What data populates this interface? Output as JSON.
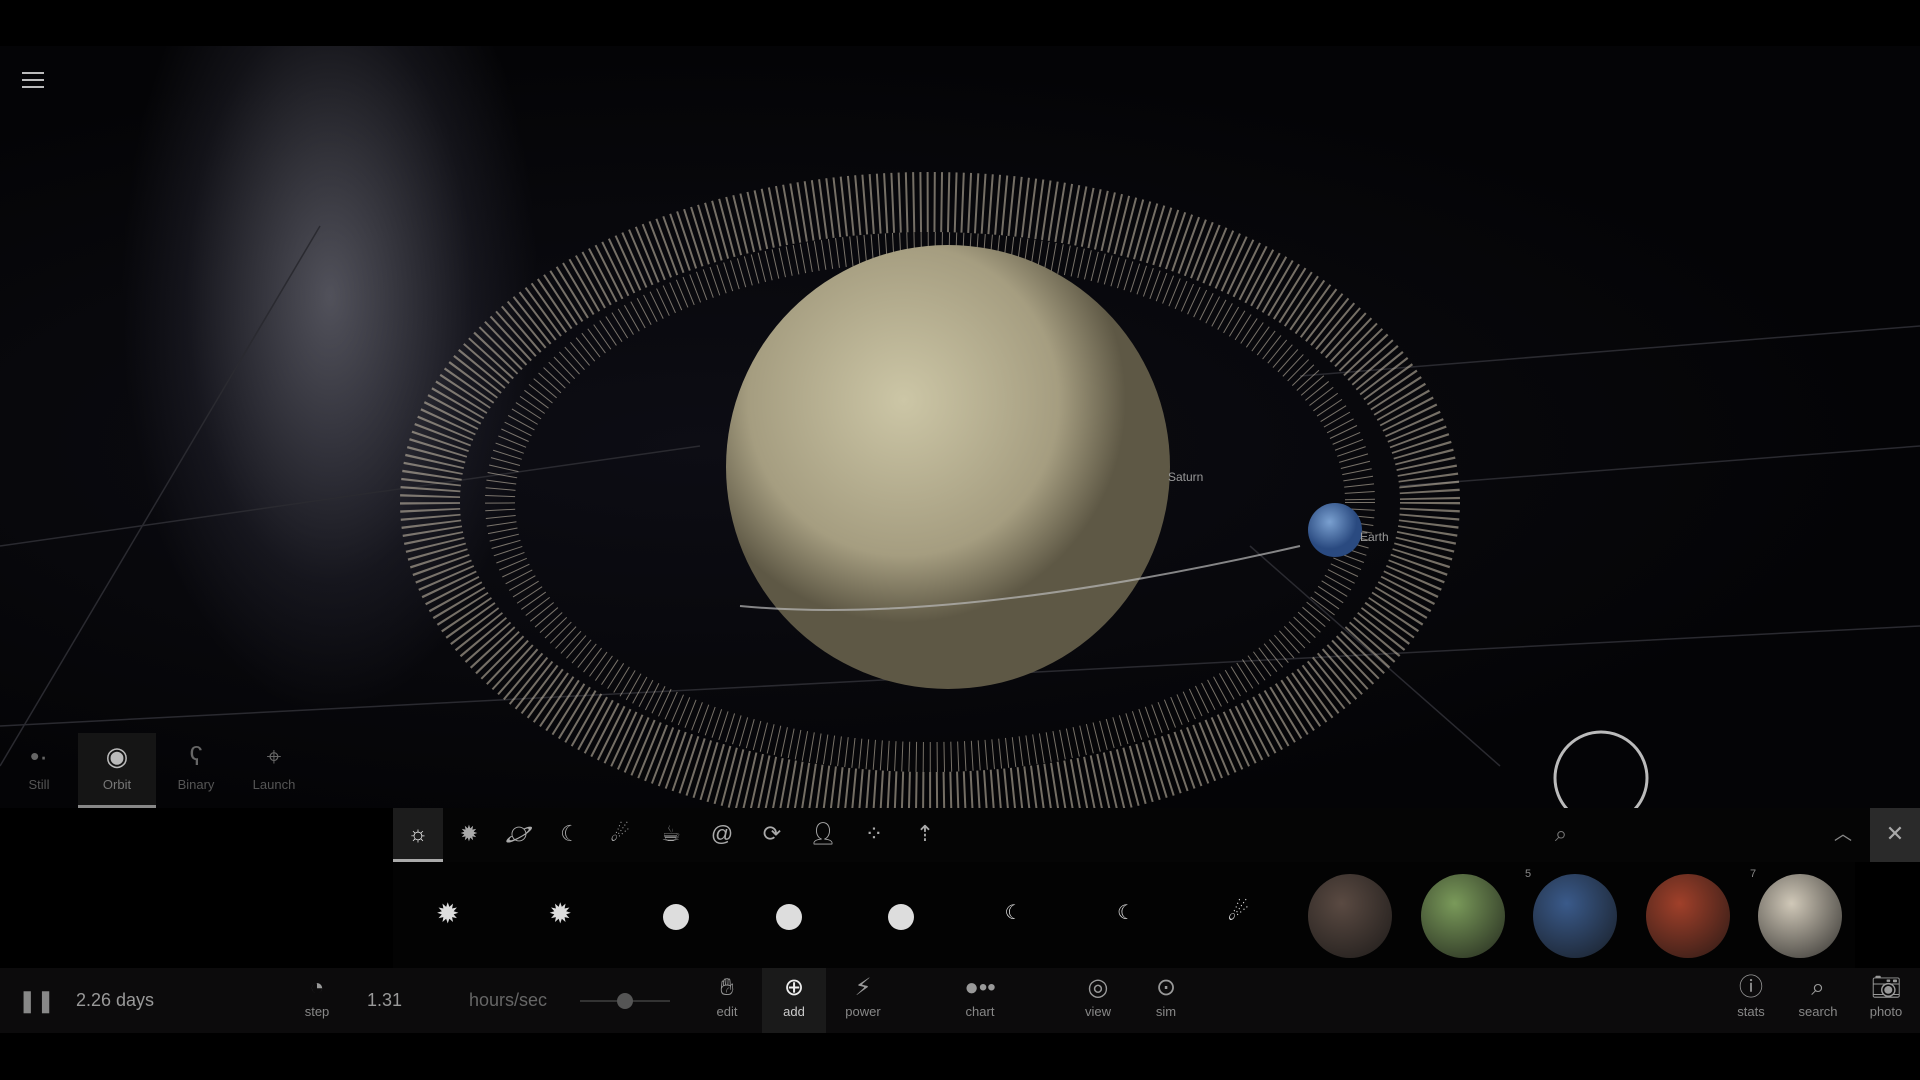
{
  "scene": {
    "labels": {
      "saturn": "Saturn",
      "earth": "Earth"
    }
  },
  "modes": [
    {
      "label": "Still",
      "icon": "still-icon"
    },
    {
      "label": "Orbit",
      "icon": "orbit-icon",
      "active": true
    },
    {
      "label": "Binary",
      "icon": "binary-icon"
    },
    {
      "label": "Launch",
      "icon": "launch-icon"
    }
  ],
  "categories": [
    "sun-planet-icon",
    "star-icon",
    "planet-ring-icon",
    "moon-icon",
    "comet-icon",
    "teapot-icon",
    "galaxy-icon",
    "black-hole-icon",
    "person-icon",
    "ring-dots-icon",
    "launch-arrow-icon"
  ],
  "palette": {
    "items": [
      {
        "kind": "star"
      },
      {
        "kind": "star"
      },
      {
        "kind": "white-dwarf"
      },
      {
        "kind": "white-dwarf"
      },
      {
        "kind": "white-dwarf"
      },
      {
        "kind": "moon"
      },
      {
        "kind": "moon"
      },
      {
        "kind": "comet"
      },
      {
        "kind": "planet",
        "color": "#5a4a42"
      },
      {
        "kind": "planet",
        "color": "#7a9a5a"
      },
      {
        "kind": "planet",
        "color": "#3a5a8a",
        "badge": "5"
      },
      {
        "kind": "planet",
        "color": "#a0402a"
      },
      {
        "kind": "planet",
        "color": "#d0c8b8",
        "badge": "7"
      }
    ]
  },
  "bottom": {
    "time": "2.26 days",
    "step": "step",
    "rate": "1.31",
    "rate_unit": "hours/sec",
    "rate_slider": 0.5,
    "tools": {
      "edit": "edit",
      "add": "add",
      "power": "power",
      "chart": "chart",
      "view": "view",
      "sim": "sim",
      "stats": "stats",
      "search": "search",
      "photo": "photo"
    }
  }
}
